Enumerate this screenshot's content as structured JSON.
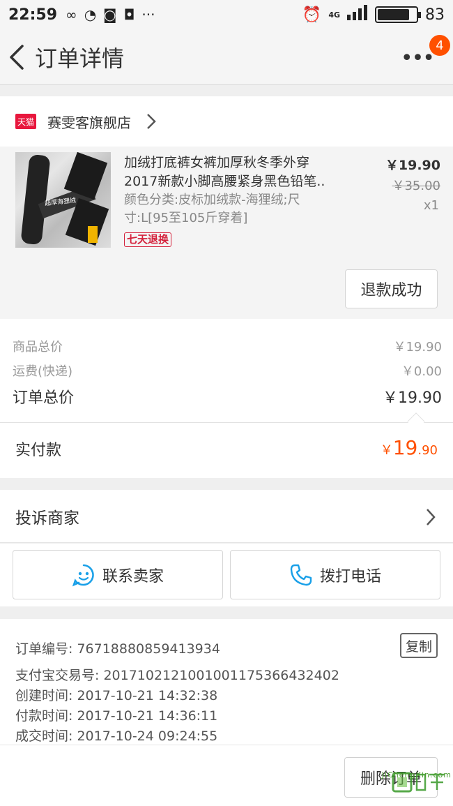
{
  "status_bar": {
    "time": "22:59",
    "icons_left": [
      "infinity-icon",
      "q-icon",
      "wifi-hotspot-icon",
      "qq-icon",
      "more-dots-icon"
    ],
    "network": "4G",
    "battery": "83",
    "battery_level": 0.83
  },
  "nav": {
    "title": "订单详情",
    "badge_count": "4"
  },
  "shop": {
    "logo_text": "天猫",
    "name": "赛雯客旗舰店"
  },
  "product": {
    "title_line1": "加绒打底裤女裤加厚秋冬季外穿",
    "title_line2": "2017新款小脚高腰紧身黑色铅笔..",
    "sku_line1": "颜色分类:皮标加绒款-海狸绒;尺",
    "sku_line2": "寸:L[95至105斤穿着]",
    "return_tag": "七天退换",
    "image_label": "超厚海狸绒",
    "price": "￥19.90",
    "original_price": "￥35.00",
    "quantity": "x1",
    "refund_status": "退款成功"
  },
  "summary": {
    "goods_total_label": "商品总价",
    "goods_total": "￥19.90",
    "shipping_label": "运费(快递)",
    "shipping": "￥0.00",
    "order_total_label": "订单总价",
    "order_total": "￥19.90",
    "paid_label": "实付款",
    "paid_currency": "￥",
    "paid_int": "19",
    "paid_dec": ".90"
  },
  "complaint": {
    "label": "投诉商家"
  },
  "contact": {
    "seller_label": "联系卖家",
    "call_label": "拨打电话"
  },
  "info": {
    "order_no": "订单编号: 76718880859413934",
    "copy_label": "复制",
    "alipay_no": "支付宝交易号: 2017102121001001175366432402",
    "created": "创建时间: 2017-10-21 14:32:38",
    "paid": "付款时间: 2017-10-21 14:36:11",
    "completed": "成交时间: 2017-10-24 09:24:55"
  },
  "bottom": {
    "delete_label": "删除订单"
  },
  "watermark": {
    "text": "JiChengXin.com"
  },
  "colors": {
    "accent": "#ff5000",
    "tmall_red": "#e8173d",
    "link_blue": "#1aa0e8"
  }
}
